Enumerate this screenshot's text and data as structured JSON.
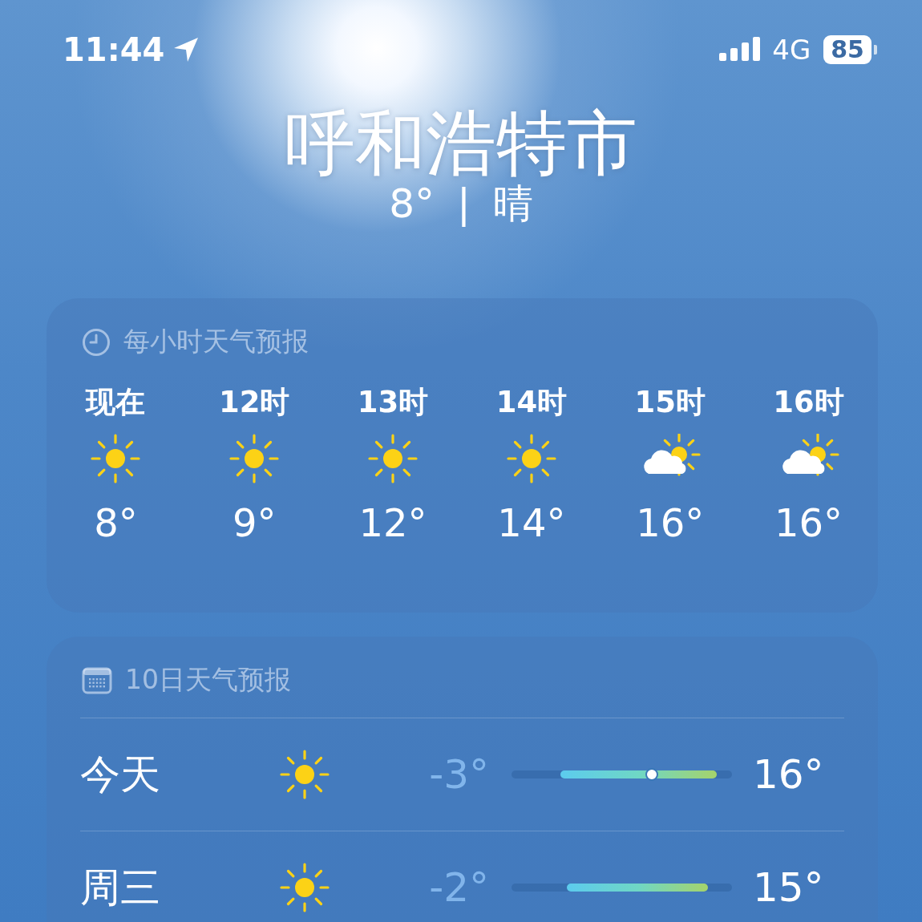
{
  "status_bar": {
    "time": "11:44",
    "network": "4G",
    "battery": "85"
  },
  "location": {
    "city": "呼和浩特市",
    "temperature": "8°",
    "separator": "|",
    "condition": "晴"
  },
  "hourly": {
    "title": "每小时天气预报",
    "hours": [
      {
        "label": "现在",
        "kind": "sun",
        "temp": "8°"
      },
      {
        "label": "12时",
        "kind": "sun",
        "temp": "9°"
      },
      {
        "label": "13时",
        "kind": "sun",
        "temp": "12°"
      },
      {
        "label": "14时",
        "kind": "sun",
        "temp": "14°"
      },
      {
        "label": "15时",
        "kind": "partly-cloudy",
        "temp": "16°"
      },
      {
        "label": "16时",
        "kind": "partly-cloudy",
        "temp": "16°"
      }
    ]
  },
  "daily": {
    "title": "10日天气预报",
    "days": [
      {
        "day": "今天",
        "kind": "sun",
        "low": "-3°",
        "high": "16°",
        "now": {
          "level": 0.63
        }
      },
      {
        "day": "周三",
        "kind": "sun",
        "low": "-2°",
        "high": "15°"
      }
    ]
  }
}
